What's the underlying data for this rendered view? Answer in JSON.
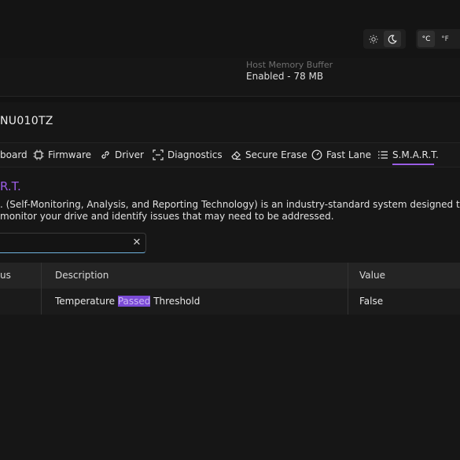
{
  "theme_toggle": {
    "light_icon": "sun-icon",
    "dark_icon": "moon-icon"
  },
  "unit_toggle": {
    "celsius": "°C",
    "fahrenheit": "°F"
  },
  "info": {
    "label": "Host Memory Buffer",
    "value": "Enabled - 78 MB"
  },
  "drive": {
    "model": "NU010TZ"
  },
  "tabs": [
    {
      "label": "board",
      "icon": "dashboard-icon"
    },
    {
      "label": "Firmware",
      "icon": "chip-icon"
    },
    {
      "label": "Driver",
      "icon": "link-icon"
    },
    {
      "label": "Diagnostics",
      "icon": "scan-icon"
    },
    {
      "label": "Secure Erase",
      "icon": "eraser-icon"
    },
    {
      "label": "Fast Lane",
      "icon": "speed-icon"
    },
    {
      "label": "S.M.A.R.T.",
      "icon": "list-icon",
      "active": true
    }
  ],
  "smart": {
    "title": "R.T.",
    "description": ". (Self-Monitoring, Analysis, and Reporting Technology) is an industry-standard system designed to monitor your drive and identify issues that may need to be addressed."
  },
  "search": {
    "value": "",
    "clear_icon": "close-icon"
  },
  "table": {
    "columns": [
      "us",
      "Description",
      "Value"
    ],
    "rows": [
      {
        "status": "",
        "description_before": "Temperature ",
        "description_match": "Passed",
        "description_after": " Threshold",
        "value": "False"
      }
    ]
  },
  "colors": {
    "accent": "#9b5de5",
    "highlight": "#7b4ad6",
    "focus": "#6fb4df"
  }
}
